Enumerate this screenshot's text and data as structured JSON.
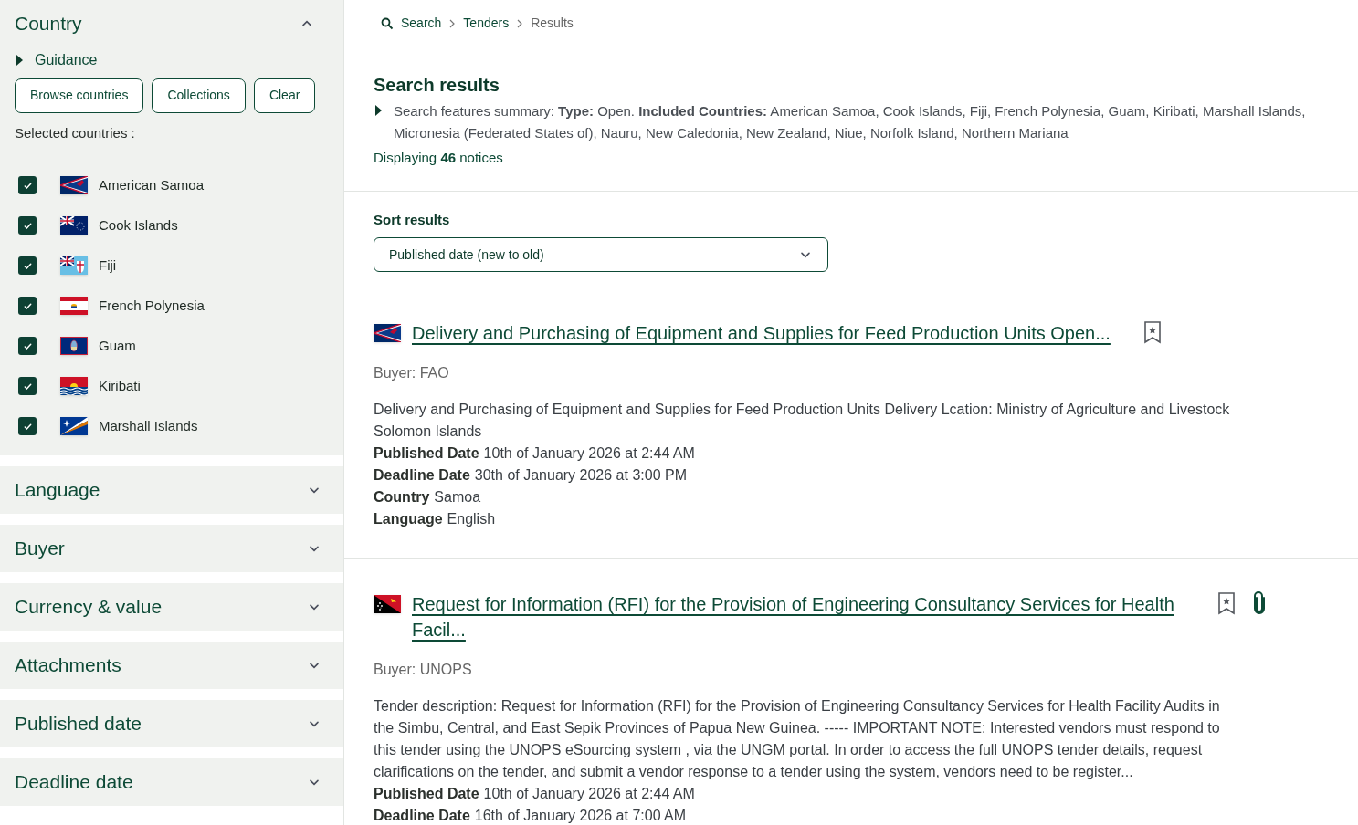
{
  "sidebar": {
    "country": {
      "title": "Country",
      "expanded": true,
      "guidance": "Guidance",
      "buttons": [
        "Browse countries",
        "Collections",
        "Clear"
      ],
      "selected_label": "Selected countries :",
      "countries": [
        {
          "name": "American Samoa",
          "kind": "as",
          "checked": true
        },
        {
          "name": "Cook Islands",
          "kind": "ck",
          "checked": true
        },
        {
          "name": "Fiji",
          "kind": "fj",
          "checked": true
        },
        {
          "name": "French Polynesia",
          "kind": "pf",
          "checked": true
        },
        {
          "name": "Guam",
          "kind": "gu",
          "checked": true
        },
        {
          "name": "Kiribati",
          "kind": "ki",
          "checked": true
        },
        {
          "name": "Marshall Islands",
          "kind": "mh",
          "checked": true
        }
      ]
    },
    "filters": [
      {
        "title": "Language",
        "expanded": false
      },
      {
        "title": "Buyer",
        "expanded": false
      },
      {
        "title": "Currency & value",
        "expanded": false
      },
      {
        "title": "Attachments",
        "expanded": false
      },
      {
        "title": "Published date",
        "expanded": false
      },
      {
        "title": "Deadline date",
        "expanded": false
      }
    ]
  },
  "breadcrumb": [
    "Search",
    "Tenders",
    "Results"
  ],
  "results_header": {
    "title": "Search results",
    "summary": "Search features summary: **Type:** Open. **Included Countries:** American Samoa, Cook Islands, Fiji, French Polynesia, Guam, Kiribati, Marshall Islands, Micronesia (Federated States of), Nauru, New Caledonia, New Zealand, Niue, Norfolk Island, Northern Mariana",
    "count": "Displaying **46** notices"
  },
  "sort": {
    "label": "Sort results",
    "value": "Published date (new to old)"
  },
  "results": [
    {
      "kind": "as",
      "title": "Delivery and Purchasing of Equipment and Supplies for Feed Production Units Open...",
      "has_attachment": false,
      "buyer": "Buyer: FAO",
      "description": "Delivery and Purchasing of Equipment and Supplies for Feed Production Units Delivery Lcation: Ministry of Agriculture and Livestock Solomon Islands",
      "fields": [
        {
          "label": "Published Date",
          "value": "10th of January 2026 at 2:44 AM"
        },
        {
          "label": "Deadline Date",
          "value": "30th of January 2026 at 3:00 PM"
        },
        {
          "label": "Country",
          "value": "Samoa"
        },
        {
          "label": "Language",
          "value": "English"
        }
      ]
    },
    {
      "kind": "pg",
      "title": "Request for Information (RFI) for the Provision of Engineering Consultancy Services for Health Facil...",
      "has_attachment": true,
      "buyer": "Buyer: UNOPS",
      "description": "Tender description: Request for Information (RFI) for the Provision of Engineering Consultancy Services for Health Facility Audits in the Simbu, Central, and East Sepik Provinces of Papua New Guinea. ----- IMPORTANT NOTE: Interested vendors  must respond to this tender using the UNOPS eSourcing system , via the UNGM portal. In order to access the full UNOPS tender details, request clarifications on the tender, and submit a vendor response to a tender using the system, vendors need to be register...",
      "fields": [
        {
          "label": "Published Date",
          "value": "10th of January 2026 at 2:44 AM"
        },
        {
          "label": "Deadline Date",
          "value": "16th of January 2026 at 7:00 AM"
        }
      ]
    }
  ]
}
